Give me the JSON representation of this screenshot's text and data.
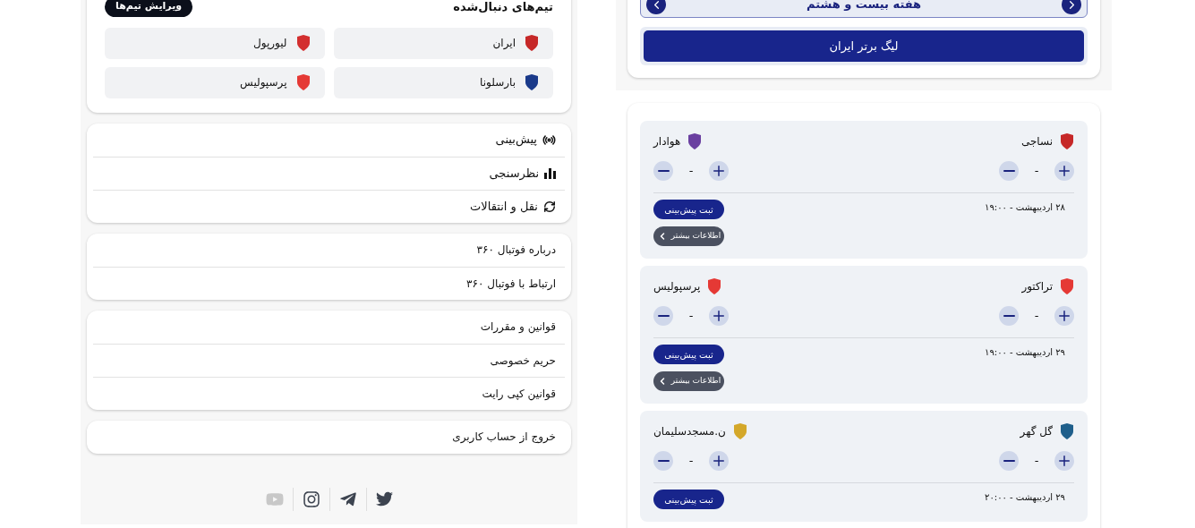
{
  "followed_teams": {
    "title": "تیم‌های دنبال‌شده",
    "edit_button": "ویرایش تیم‌ها",
    "teams": [
      {
        "name": "ایران",
        "color": "#c62828"
      },
      {
        "name": "لیورپول",
        "color": "#d32f2f"
      },
      {
        "name": "بارسلونا",
        "color": "#1a3a8a"
      },
      {
        "name": "پرسپولیس",
        "color": "#e53935"
      }
    ]
  },
  "menu_groups": [
    [
      {
        "label": "پیش‌بینی",
        "kind": "prediction"
      },
      {
        "label": "نظرسنجی",
        "kind": "poll"
      },
      {
        "label": "نقل و انتقالات",
        "kind": "transfers"
      }
    ],
    [
      {
        "label": "درباره فوتبال ۳۶۰"
      },
      {
        "label": "ارتباط با فوتبال ۳۶۰"
      }
    ],
    [
      {
        "label": "قوانین و مقررات"
      },
      {
        "label": "حریم خصوصی"
      },
      {
        "label": "قوانین کپی رایت"
      }
    ],
    [
      {
        "label": "خروج از حساب کاربری"
      }
    ]
  ],
  "social": [
    {
      "kind": "twitter",
      "disabled": false
    },
    {
      "kind": "telegram",
      "disabled": false
    },
    {
      "kind": "instagram",
      "disabled": false
    },
    {
      "kind": "youtube",
      "disabled": true
    }
  ],
  "week_nav": {
    "title": "هفته بیست و هشتم"
  },
  "league_button": "لیگ برتر ایران",
  "matches": [
    {
      "home": {
        "name": "نساجی",
        "color": "#c62828"
      },
      "away": {
        "name": "هوادار",
        "color": "#6a3fa0"
      },
      "home_score": "-",
      "away_score": "-",
      "date": "۲۸ اردیبهشت - ۱۹:۰۰",
      "predict_button": "ثبت پیش‌بینی",
      "info_button": "اطلاعات بیشتر"
    },
    {
      "home": {
        "name": "تراکتور",
        "color": "#e53935"
      },
      "away": {
        "name": "پرسپولیس",
        "color": "#e53935"
      },
      "home_score": "-",
      "away_score": "-",
      "date": "۲۹ اردیبهشت - ۱۹:۰۰",
      "predict_button": "ثبت پیش‌بینی",
      "info_button": "اطلاعات بیشتر"
    },
    {
      "home": {
        "name": "گل گهر",
        "color": "#1f5f8b"
      },
      "away": {
        "name": "ن.مسجدسلیمان",
        "color": "#d4a82a"
      },
      "home_score": "-",
      "away_score": "-",
      "date": "۲۹ اردیبهشت - ۲۰:۰۰",
      "predict_button": "ثبت پیش‌بینی"
    }
  ]
}
